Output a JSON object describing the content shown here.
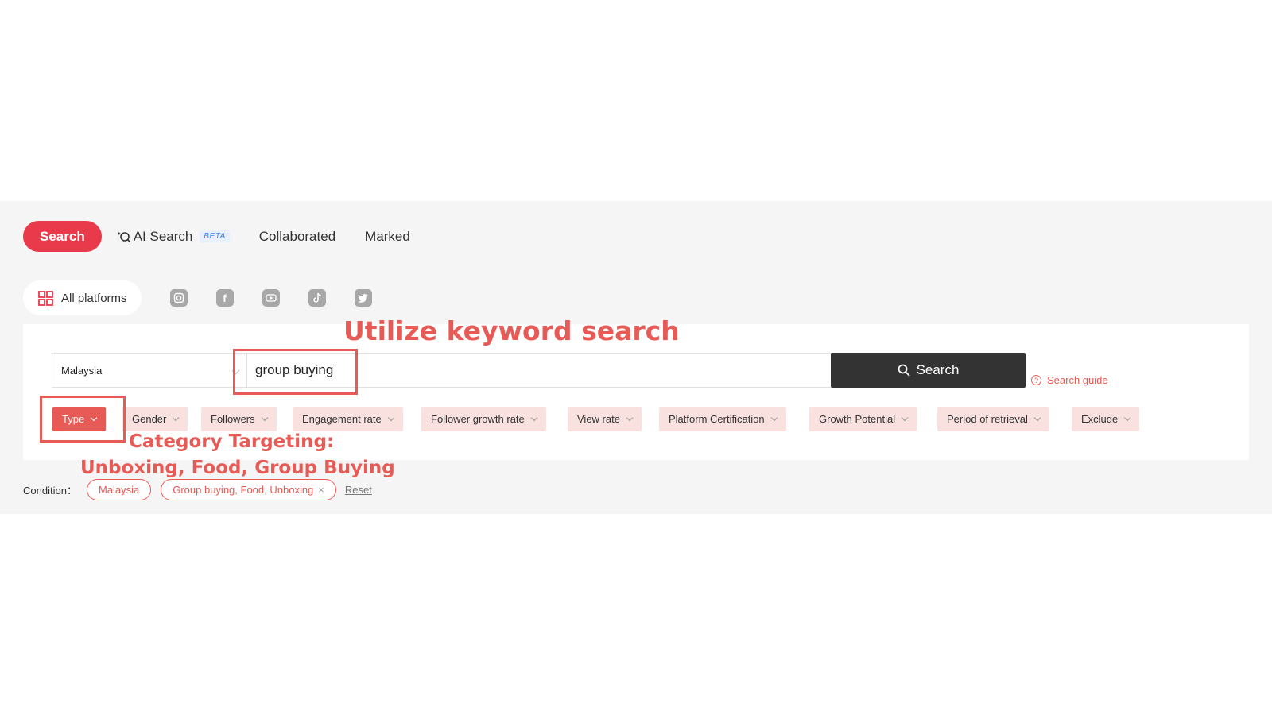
{
  "tabs": {
    "search": "Search",
    "ai_search": "AI Search",
    "beta": "BETA",
    "collaborated": "Collaborated",
    "marked": "Marked"
  },
  "platforms": {
    "all": "All platforms",
    "icons": [
      "instagram-icon",
      "facebook-icon",
      "youtube-icon",
      "tiktok-icon",
      "twitter-icon"
    ]
  },
  "search": {
    "country": "Malaysia",
    "keyword": "group buying",
    "button": "Search",
    "guide": "Search guide"
  },
  "filters": [
    "Type",
    "Gender",
    "Followers",
    "Engagement rate",
    "Follower growth rate",
    "View rate",
    "Platform Certification",
    "Growth Potential",
    "Period of retrieval",
    "Exclude"
  ],
  "conditions": {
    "label": "Condition：",
    "tags": [
      "Malaysia",
      "Group buying, Food, Unboxing"
    ],
    "reset": "Reset"
  },
  "annotations": {
    "keyword": "Utilize keyword search",
    "category_line1": "Category Targeting:",
    "category_line2": "Unboxing, Food, Group Buying"
  },
  "colors": {
    "accent": "#e83a4b",
    "annotation": "#e85a55",
    "chip_bg": "#f8e1df",
    "search_button": "#333333"
  }
}
